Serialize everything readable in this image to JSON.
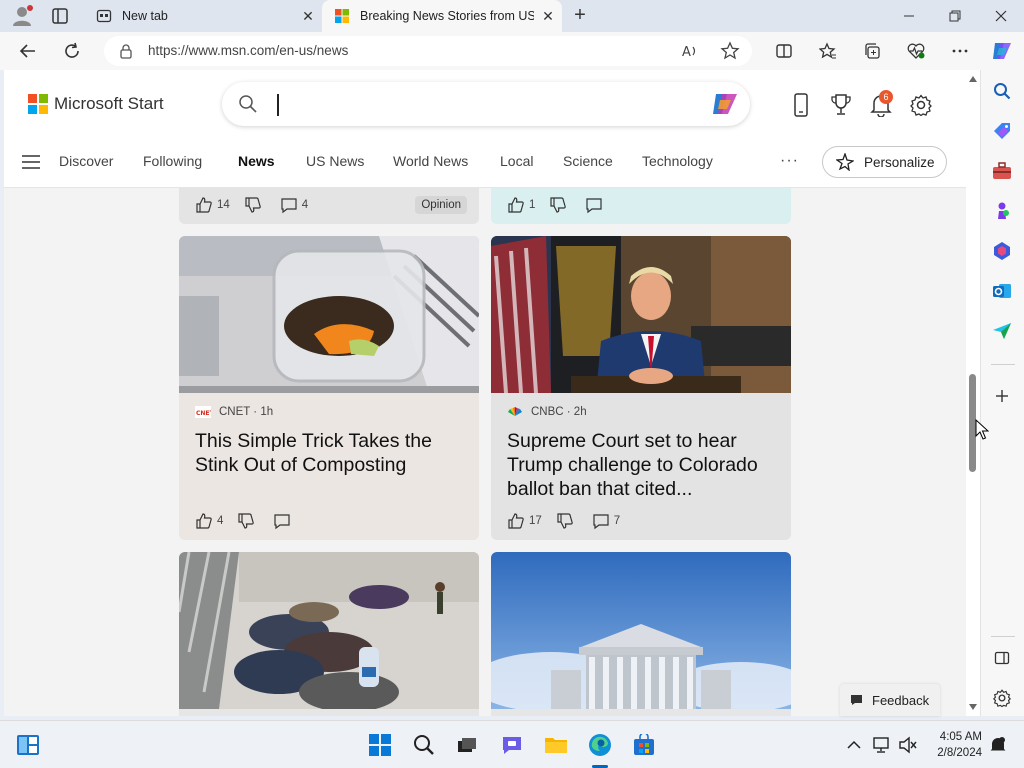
{
  "browser": {
    "tabs": [
      {
        "title": "New tab",
        "active": false
      },
      {
        "title": "Breaking News Stories from US and Around the World",
        "active": true
      }
    ],
    "close_symbol": "✕",
    "new_tab_symbol": "+",
    "url": "https://www.msn.com/en-us/news"
  },
  "msn": {
    "brand": "Microsoft Start",
    "notification_count": "6",
    "nav_items": [
      {
        "label": "Discover",
        "active": false
      },
      {
        "label": "Following",
        "active": false
      },
      {
        "label": "News",
        "active": true
      },
      {
        "label": "US News",
        "active": false
      },
      {
        "label": "World News",
        "active": false
      },
      {
        "label": "Local",
        "active": false
      },
      {
        "label": "Science",
        "active": false
      },
      {
        "label": "Technology",
        "active": false
      }
    ],
    "more_label": "···",
    "personalize_label": "Personalize",
    "feedback_label": "Feedback"
  },
  "cards": [
    {
      "id": "top-left",
      "likes": "14",
      "comments": "4",
      "badge": "Opinion"
    },
    {
      "id": "top-right",
      "likes": "1",
      "comments": ""
    },
    {
      "id": "compost",
      "source": "CNET · 1h",
      "title": "This Simple Trick Takes the Stink Out of Composting",
      "likes": "4",
      "comments": ""
    },
    {
      "id": "trump",
      "source": "CNBC · 2h",
      "title": "Supreme Court set to hear Trump challenge to Colorado ballot ban that cited...",
      "likes": "17",
      "comments": "7"
    },
    {
      "id": "migrants",
      "source": "",
      "title": ""
    },
    {
      "id": "court",
      "source": "",
      "title": ""
    }
  ],
  "taskbar": {
    "time": "4:05 AM",
    "date": "2/8/2024"
  },
  "colors": {
    "accent_blue": "#0067c0",
    "ms_red": "#f25022",
    "ms_green": "#7fba00",
    "ms_blue": "#00a4ef",
    "ms_yellow": "#ffb900"
  }
}
